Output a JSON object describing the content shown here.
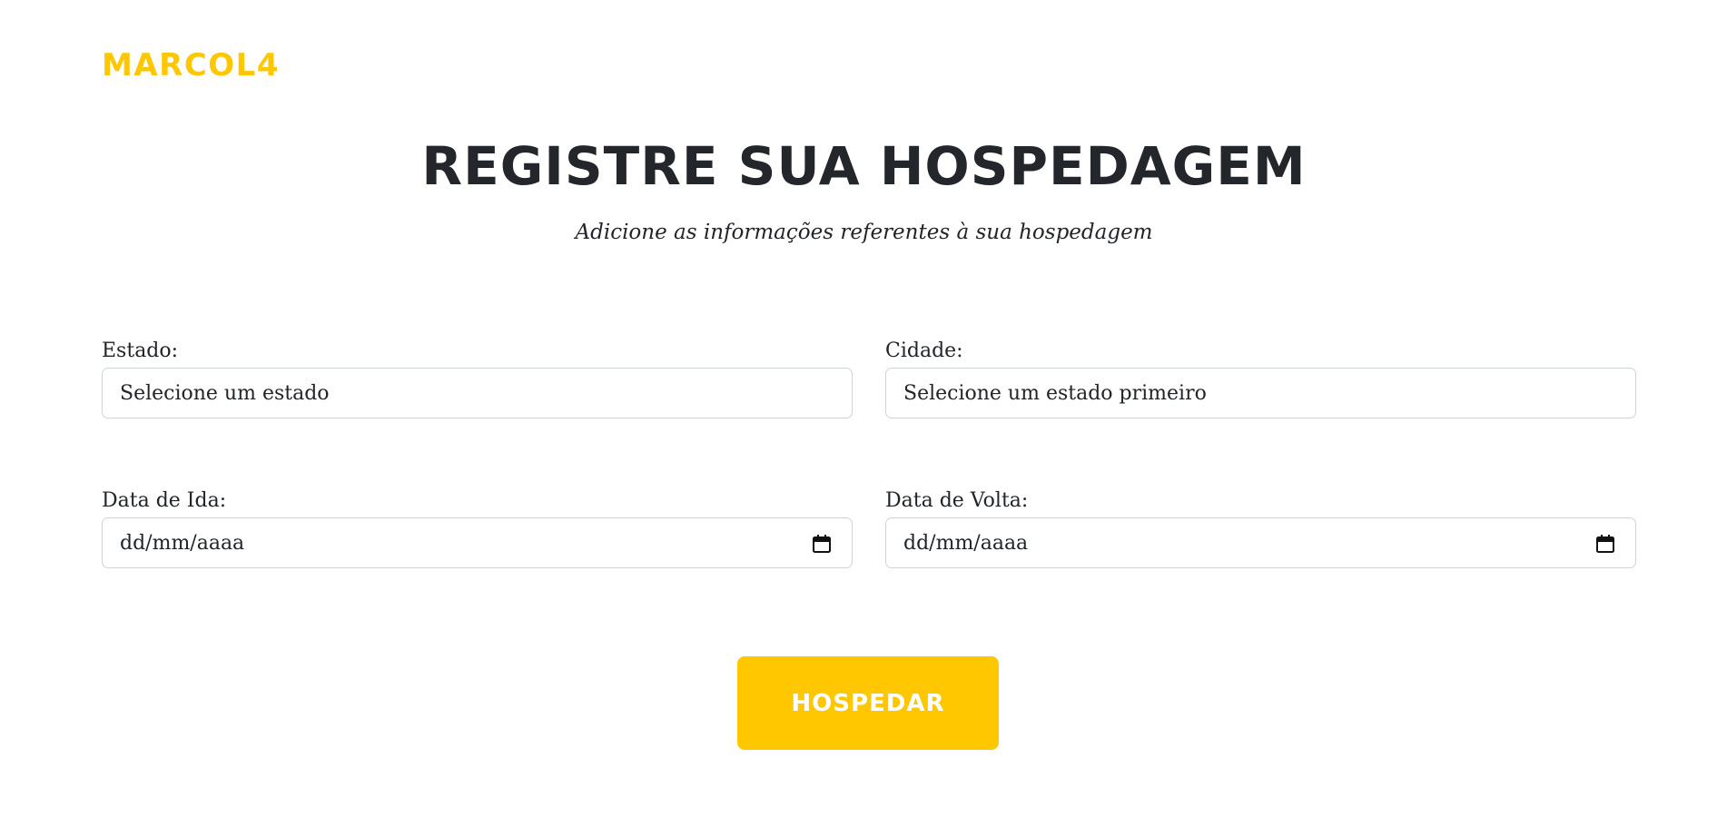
{
  "brand": {
    "name": "MARCOL4",
    "color": "#ffc700"
  },
  "header": {
    "title": "REGISTRE SUA HOSPEDAGEM",
    "subtitle": "Adicione as informações referentes à sua hospedagem"
  },
  "form": {
    "estado": {
      "label": "Estado:",
      "selected": "Selecione um estado"
    },
    "cidade": {
      "label": "Cidade:",
      "selected": "Selecione um estado primeiro"
    },
    "data_ida": {
      "label": "Data de Ida:",
      "placeholder": "dd/mm/aaaa",
      "icon": "calendar-icon"
    },
    "data_volta": {
      "label": "Data de Volta:",
      "placeholder": "dd/mm/aaaa",
      "icon": "calendar-icon"
    },
    "submit": {
      "label": "HOSPEDAR",
      "color": "#ffc700"
    }
  }
}
